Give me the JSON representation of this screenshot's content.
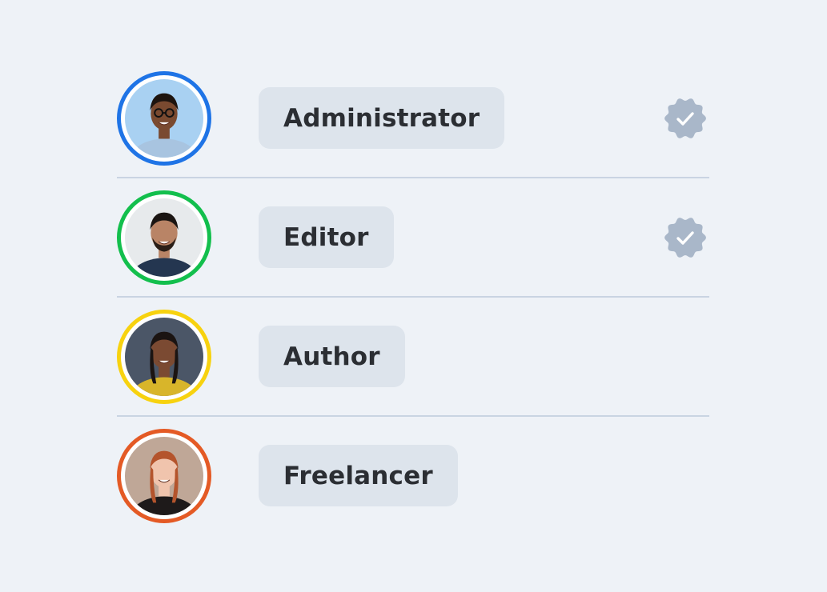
{
  "roles": [
    {
      "label": "Administrator",
      "ring_color": "#1f74e6",
      "verified": true,
      "avatar": "man-with-glasses-photo",
      "bg": "#a9d1f2",
      "skin": "#7a4a30",
      "hair": "#1d140f",
      "shirt": "#a8c4e0"
    },
    {
      "label": "Editor",
      "ring_color": "#13bf4d",
      "verified": true,
      "avatar": "bearded-man-photo",
      "bg": "#e7eaec",
      "skin": "#b98466",
      "hair": "#1a1512",
      "shirt": "#243650"
    },
    {
      "label": "Author",
      "ring_color": "#f7d20f",
      "verified": false,
      "avatar": "woman-with-braids-photo",
      "bg": "#4b5667",
      "skin": "#7b4a32",
      "hair": "#1b1412",
      "shirt": "#d8b52a"
    },
    {
      "label": "Freelancer",
      "ring_color": "#e45a25",
      "verified": false,
      "avatar": "red-haired-woman-photo",
      "bg": "#bfa797",
      "skin": "#f0c4ad",
      "hair": "#b4542c",
      "shirt": "#1e1a1a"
    }
  ],
  "verified_icon": {
    "name": "verified-badge-icon",
    "color": "#a9b7c9"
  }
}
